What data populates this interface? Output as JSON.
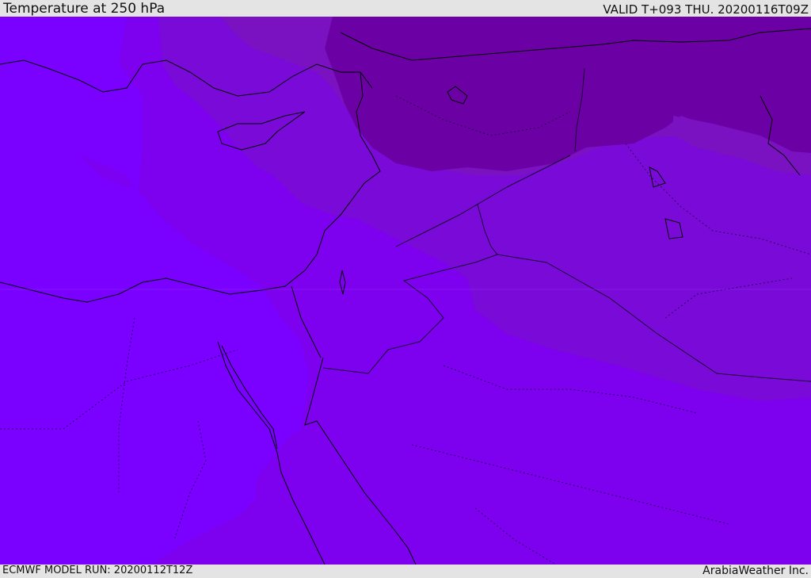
{
  "header": {
    "title": "Temperature at 250 hPa",
    "valid": "VALID T+093 THU. 20200116T09Z"
  },
  "footer": {
    "model_run": "ECMWF MODEL RUN: 20200112T12Z",
    "credit": "ArabiaWeather Inc."
  },
  "colors": {
    "band_warmest": "#7a00ff",
    "band_warm": "#7d00ee",
    "band_mid": "#7a0ad8",
    "band_cool": "#7a12c2",
    "band_cold": "#6b00a5",
    "coastline": "#000000",
    "border": "#1a0033",
    "chrome": "#e4e4e4"
  }
}
